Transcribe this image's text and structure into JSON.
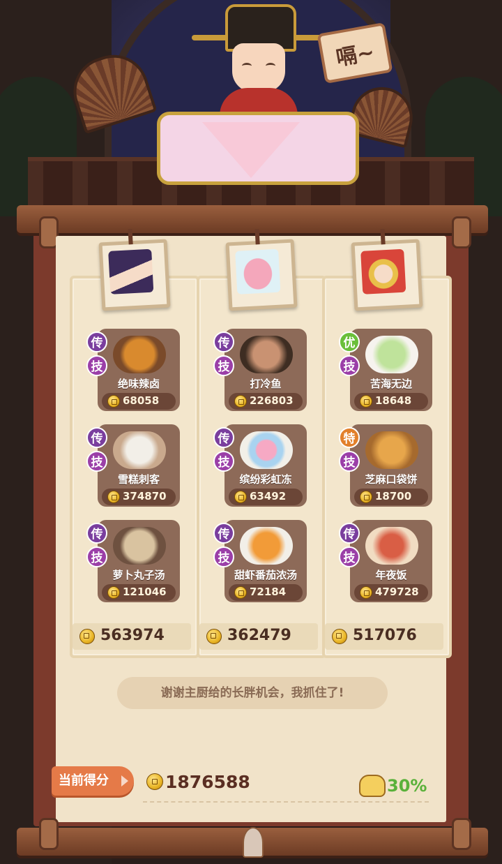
{
  "header": {
    "speech_text": "嗝~"
  },
  "colors": {
    "rank_legend": "#7a3e9e",
    "rank_excellent": "#6abf3a",
    "rank_special": "#e2802b",
    "skill": "#9b3fa8"
  },
  "columns": [
    {
      "portrait_icon": "chef-girl-portrait",
      "dishes": [
        {
          "rank": "传",
          "rank_type": "legend",
          "skill": "技",
          "name": "绝味辣卤",
          "score": "68058",
          "dish_icon": "spicy-braised-dish"
        },
        {
          "rank": "传",
          "rank_type": "legend",
          "skill": "技",
          "name": "雪糕刺客",
          "score": "374870",
          "dish_icon": "ice-cream-assassin"
        },
        {
          "rank": "传",
          "rank_type": "legend",
          "skill": "技",
          "name": "萝卜丸子汤",
          "score": "121046",
          "dish_icon": "meatball-soup"
        }
      ],
      "total": "563974"
    },
    {
      "portrait_icon": "pink-dolphin-portrait",
      "dishes": [
        {
          "rank": "传",
          "rank_type": "legend",
          "skill": "技",
          "name": "打冷鱼",
          "score": "226803",
          "dish_icon": "cold-fish-platter"
        },
        {
          "rank": "传",
          "rank_type": "legend",
          "skill": "技",
          "name": "缤纷彩虹冻",
          "score": "63492",
          "dish_icon": "rainbow-jelly"
        },
        {
          "rank": "传",
          "rank_type": "legend",
          "skill": "技",
          "name": "甜虾番茄浓汤",
          "score": "72184",
          "dish_icon": "shrimp-tomato-soup"
        }
      ],
      "total": "362479"
    },
    {
      "portrait_icon": "opera-king-portrait",
      "dishes": [
        {
          "rank": "优",
          "rank_type": "excellent",
          "skill": "技",
          "name": "苦海无边",
          "score": "18648",
          "dish_icon": "green-dumplings"
        },
        {
          "rank": "特",
          "rank_type": "special",
          "skill": "技",
          "name": "芝麻口袋饼",
          "score": "18700",
          "dish_icon": "sesame-pocket-bread"
        },
        {
          "rank": "传",
          "rank_type": "legend",
          "skill": "技",
          "name": "年夜饭",
          "score": "479728",
          "dish_icon": "new-year-feast"
        }
      ],
      "total": "517076"
    }
  ],
  "quote": "谢谢主厨给的长胖机会，我抓住了!",
  "footer": {
    "current_score_label": "当前得分",
    "current_score": "1876588",
    "bonus": "30%"
  }
}
